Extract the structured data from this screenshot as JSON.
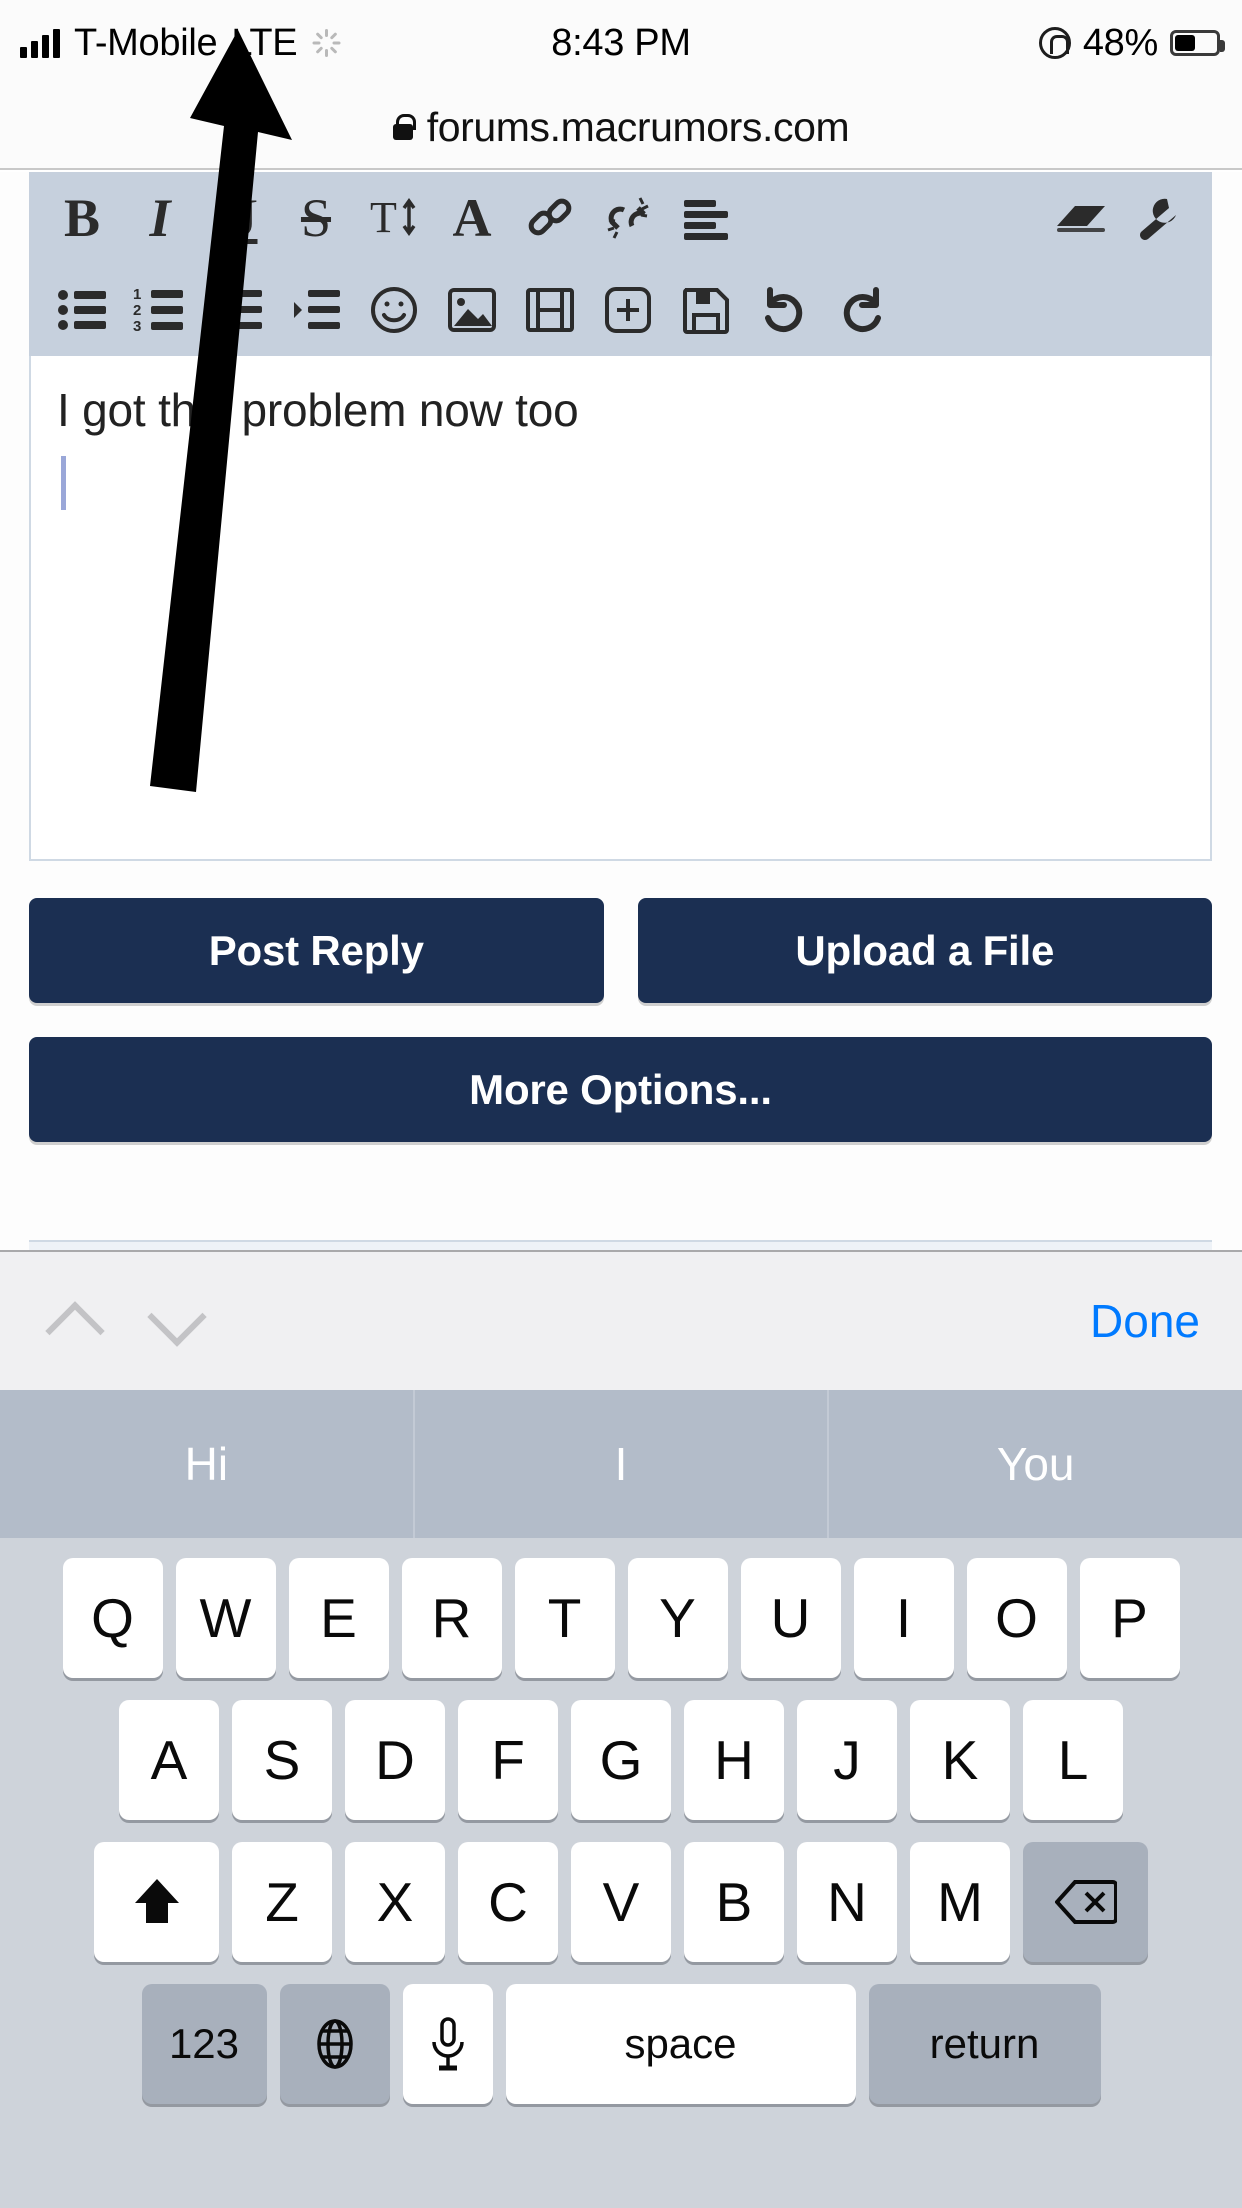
{
  "status_bar": {
    "carrier": "T-Mobile",
    "network": "LTE",
    "time": "8:43 PM",
    "battery_percent": "48%",
    "signal_icon": "signal-bars-icon",
    "activity_icon": "activity-spinner-icon",
    "rotation_lock_icon": "rotation-lock-icon",
    "battery_icon": "battery-icon"
  },
  "browser": {
    "lock_icon": "lock-icon",
    "url": "forums.macrumors.com"
  },
  "editor": {
    "toolbar_row1": [
      {
        "name": "bold-button",
        "label": "B",
        "style": "bold"
      },
      {
        "name": "italic-button",
        "label": "I",
        "style": "italic"
      },
      {
        "name": "underline-button",
        "label": "U",
        "style": "underline"
      },
      {
        "name": "strikethrough-button",
        "label": "S",
        "style": "strike"
      },
      {
        "name": "font-size-button",
        "label": "T",
        "style": "size"
      },
      {
        "name": "text-color-button",
        "label": "A",
        "style": "color"
      },
      {
        "name": "link-icon",
        "label": "",
        "style": "icon"
      },
      {
        "name": "unlink-icon",
        "label": "",
        "style": "icon"
      },
      {
        "name": "align-left-icon",
        "label": "",
        "style": "icon"
      },
      {
        "name": "eraser-icon",
        "label": "",
        "style": "icon"
      },
      {
        "name": "wrench-icon",
        "label": "",
        "style": "icon"
      }
    ],
    "toolbar_row2": [
      {
        "name": "bullet-list-icon"
      },
      {
        "name": "numbered-list-icon"
      },
      {
        "name": "outdent-icon"
      },
      {
        "name": "indent-icon"
      },
      {
        "name": "emoji-icon"
      },
      {
        "name": "insert-image-icon"
      },
      {
        "name": "insert-video-icon"
      },
      {
        "name": "insert-more-icon"
      },
      {
        "name": "save-draft-icon"
      },
      {
        "name": "undo-icon"
      },
      {
        "name": "redo-icon"
      }
    ],
    "message_text": "I got this problem now too",
    "buttons": {
      "post_reply": "Post Reply",
      "upload_file": "Upload a File",
      "more_options": "More Options..."
    },
    "accent_color": "#1b2f52",
    "toolbar_color": "#c6d0dd"
  },
  "keyboard": {
    "accessory": {
      "prev_icon": "chevron-up-icon",
      "next_icon": "chevron-down-icon",
      "done_label": "Done",
      "done_color": "#007aff"
    },
    "predictions": [
      "Hi",
      "I",
      "You"
    ],
    "row1": [
      "Q",
      "W",
      "E",
      "R",
      "T",
      "Y",
      "U",
      "I",
      "O",
      "P"
    ],
    "row2": [
      "A",
      "S",
      "D",
      "F",
      "G",
      "H",
      "J",
      "K",
      "L"
    ],
    "row3": [
      "Z",
      "X",
      "C",
      "V",
      "B",
      "N",
      "M"
    ],
    "shift_icon": "shift-icon",
    "backspace_icon": "backspace-icon",
    "numbers_label": "123",
    "globe_icon": "globe-icon",
    "mic_icon": "microphone-icon",
    "space_label": "space",
    "return_label": "return"
  },
  "annotation": {
    "arrow_icon": "pointer-arrow-annotation"
  }
}
